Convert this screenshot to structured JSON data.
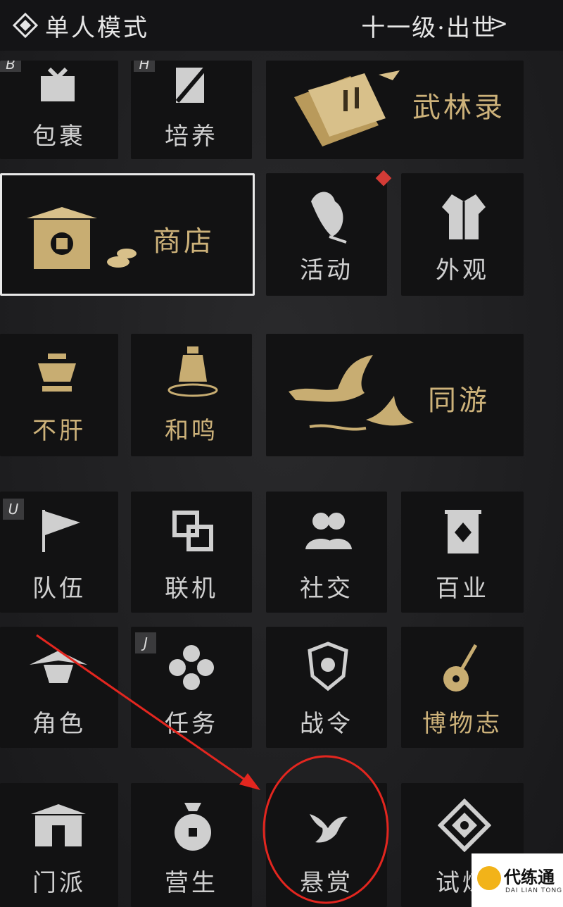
{
  "header": {
    "mode_label": "单人模式",
    "level_label": "十一级·出世",
    "chevron": ">"
  },
  "tiles": {
    "baoguo": {
      "label": "包裹",
      "key": "B"
    },
    "peiyang": {
      "label": "培养",
      "key": "H"
    },
    "wulinlu": {
      "label": "武林录"
    },
    "shangdian": {
      "label": "商店"
    },
    "huodong": {
      "label": "活动"
    },
    "waiguan": {
      "label": "外观"
    },
    "bugan": {
      "label": "不肝"
    },
    "heming": {
      "label": "和鸣"
    },
    "tongyou": {
      "label": "同游"
    },
    "duiwu": {
      "label": "队伍",
      "key": "U"
    },
    "lianji": {
      "label": "联机"
    },
    "shejiao": {
      "label": "社交"
    },
    "baiye": {
      "label": "百业"
    },
    "juese": {
      "label": "角色"
    },
    "renwu": {
      "label": "任务",
      "key": "J"
    },
    "zhanling": {
      "label": "战令"
    },
    "bowuzhi": {
      "label": "博物志"
    },
    "menpai": {
      "label": "门派"
    },
    "yingsheng": {
      "label": "营生"
    },
    "xuanshang": {
      "label": "悬赏"
    },
    "shilian": {
      "label": "试炼"
    }
  },
  "watermark": {
    "text": "代练通",
    "sub": "DAI LIAN TONG"
  },
  "colors": {
    "gold": "#cdb27a",
    "silver": "#d0d0d0",
    "annotation_red": "#e3261f",
    "notice_badge": "#d33b36"
  }
}
